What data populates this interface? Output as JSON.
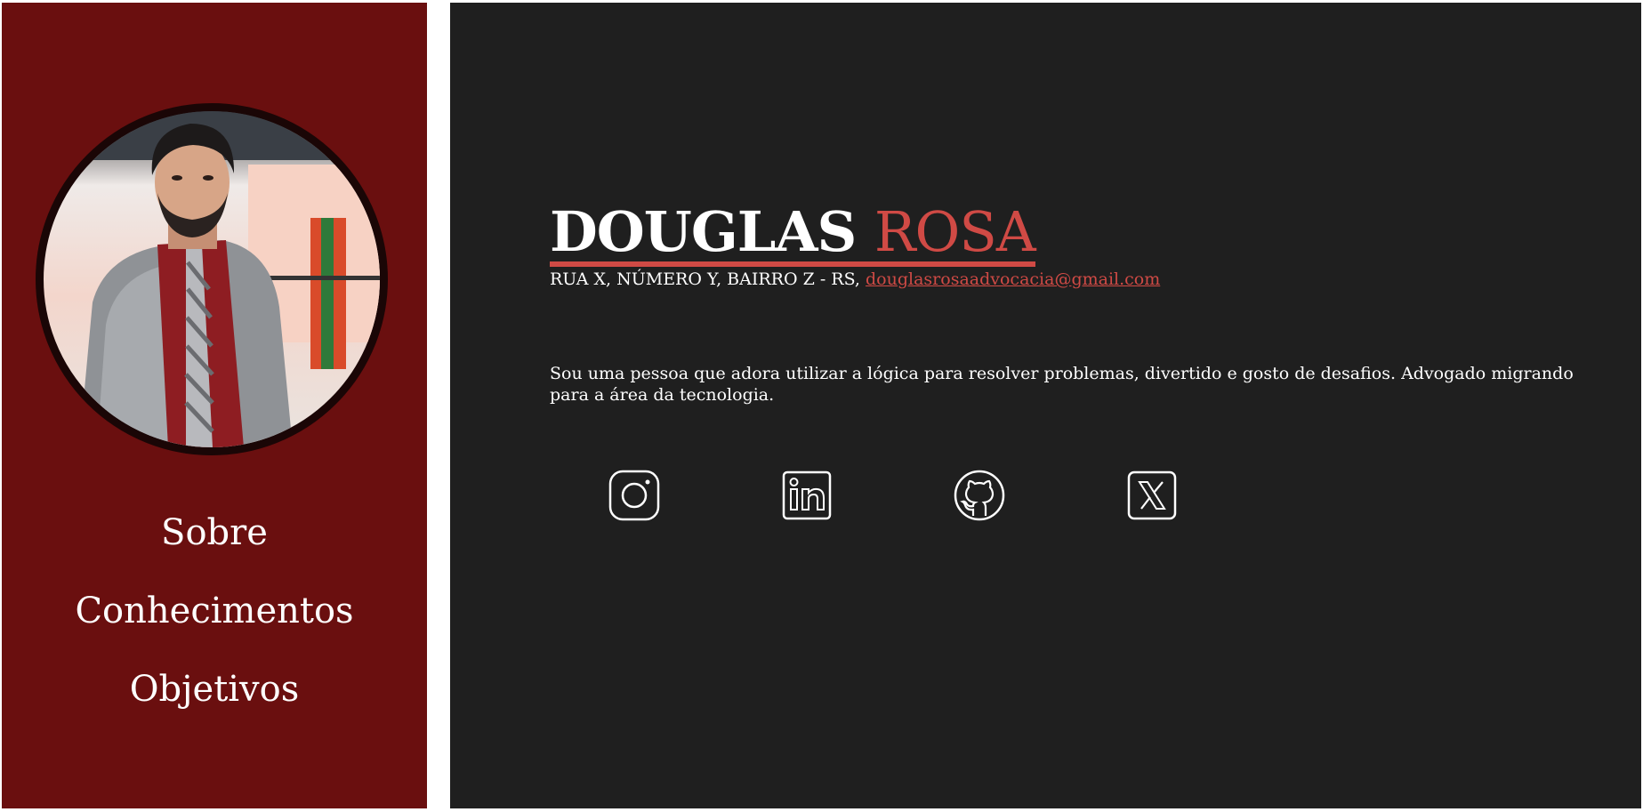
{
  "sidebar": {
    "background_color": "#6a0f0f",
    "nav": [
      {
        "label": "Sobre"
      },
      {
        "label": "Conhecimentos"
      },
      {
        "label": "Objetivos"
      }
    ]
  },
  "profile": {
    "first_name": "DOUGLAS",
    "last_name": "ROSA",
    "address": "RUA X, NÚMERO Y, BAIRRO Z - RS,",
    "email": "douglasrosaadvocacia@gmail.com",
    "bio": "Sou uma pessoa que adora utilizar a lógica para resolver problemas, divertido e gosto de desafios. Advogado migrando para a área da tecnologia."
  },
  "social": [
    {
      "icon": "instagram-icon"
    },
    {
      "icon": "linkedin-icon"
    },
    {
      "icon": "github-icon"
    },
    {
      "icon": "x-twitter-icon"
    }
  ],
  "colors": {
    "accent": "#d04a45",
    "main_background": "#1f1f1f",
    "text": "#ffffff"
  }
}
